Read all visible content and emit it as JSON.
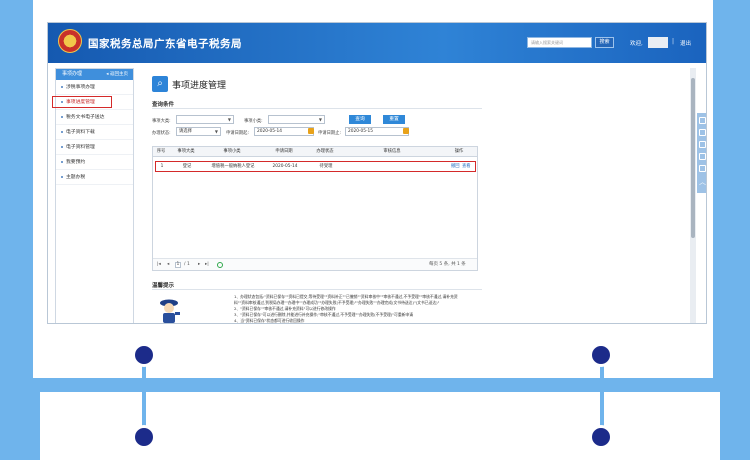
{
  "header": {
    "title": "国家税务总局广东省电子税务局",
    "search_placeholder": "请输入搜索关键词",
    "search_button": "搜索",
    "welcome": "欢迎,",
    "separator": "|",
    "exit": "退出"
  },
  "sidebar": {
    "head": "事项办理",
    "back": "◂ 返回主页",
    "items": [
      {
        "label": "涉税事项办理"
      },
      {
        "label": "事项进度管理"
      },
      {
        "label": "税务文书电子送达"
      },
      {
        "label": "电子资料下载"
      },
      {
        "label": "电子资料管理"
      },
      {
        "label": "我要预约"
      },
      {
        "label": "主题办税"
      }
    ]
  },
  "main": {
    "title": "事项进度管理",
    "query_label": "查询条件",
    "filters": {
      "category_label": "事项大类:",
      "subcategory_label": "事项小类:",
      "status_label": "办理状态:",
      "status_value": "请选择",
      "date_start_label": "申请日期起:",
      "date_start_value": "2020-05-14",
      "date_end_label": "申请日期止:",
      "date_end_value": "2020-05-15"
    },
    "buttons": {
      "query": "查询",
      "reset": "重置"
    },
    "table": {
      "columns": [
        "序号",
        "事项大类",
        "事项小类",
        "申请日期",
        "办理状态",
        "审核信息",
        "操作"
      ],
      "rows": [
        {
          "no": "1",
          "category": "登记",
          "subcategory": "增值税一般纳税人登记",
          "date": "2020-05-14",
          "status": "待受理",
          "review": "",
          "actions": [
            "撤回",
            "查看"
          ]
        }
      ]
    },
    "pager": {
      "first": "|◂",
      "prev": "◂",
      "page": "1",
      "total": "/ 1",
      "next": "▸",
      "last": "▸|",
      "summary": "每页 5 条, 共 1 条"
    },
    "tips": {
      "title": "温馨提示",
      "lines": [
        "1、办理状态包括:\"资料已保存\"\"资料已提交,等待受理\"\"资料补正\"\"已撤销\"\"资料审核中\"\"审核不通过,不予受理\"\"审核不通过,请补充资",
        "料\"\"资料审核通过,到税局办理\"\"办理中\"\"办理成功\"\"办理失败(不予受理)\"\"办理失败\"\"办理完成(文书待送达)\"(文书已送达)\"",
        "2、\"资料已保存\"\"审核不通过,请补充资料\"可以进行修改操作",
        "3、\"资料已保存\"可以进行删除,并能进行补充操作;\"审核不通过,不予受理\"\"办理失败(不予受理)\"可重新申请",
        "4、当\"资料已保存\"状态都可进行收回操作"
      ]
    }
  }
}
